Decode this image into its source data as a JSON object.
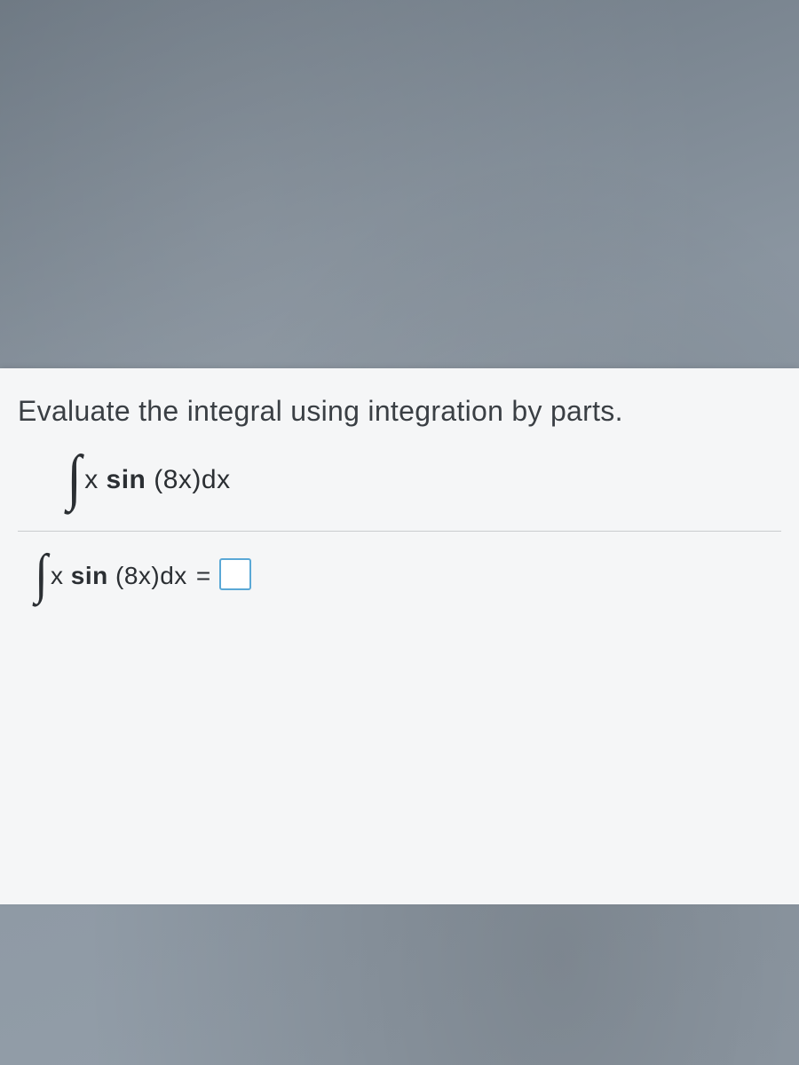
{
  "problem": {
    "prompt": "Evaluate the integral using integration by parts.",
    "integrand_prefix": "x ",
    "integrand_func": "sin",
    "integrand_suffix": " (8x)dx",
    "equals": "="
  }
}
